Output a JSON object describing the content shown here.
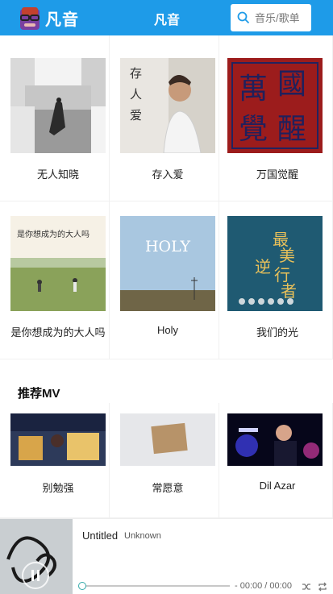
{
  "header": {
    "logo_text": "凡音",
    "title": "凡音",
    "search_placeholder": "音乐/歌单"
  },
  "albums": [
    {
      "title": "无人知晓"
    },
    {
      "title": "存入爱"
    },
    {
      "title": "万国觉醒"
    },
    {
      "title": "是你想成为的大人吗"
    },
    {
      "title": "Holy"
    },
    {
      "title": "我们的光"
    }
  ],
  "album_cover_text": {
    "cover2": {
      "line1": "存",
      "line2": "人",
      "line3": "爱"
    },
    "cover3": {
      "chars": [
        "萬",
        "國",
        "覺",
        "醒"
      ]
    },
    "cover4": {
      "line1": "是你想成为的大人吗"
    },
    "cover5": {
      "line1": "HOLY"
    },
    "cover6": {
      "chars": [
        "最",
        "美",
        "逆",
        "行",
        "者"
      ]
    }
  },
  "mv_section": {
    "title": "推荐MV",
    "items": [
      {
        "title": "别勉强"
      },
      {
        "title": "常愿意"
      },
      {
        "title": "Dil Azar"
      }
    ]
  },
  "player": {
    "title": "Untitled",
    "artist": "Unknown",
    "time": "- 00:00 / 00:00",
    "progress": 0
  },
  "colors": {
    "header_bg": "#1e9be8",
    "white": "#ffffff"
  }
}
